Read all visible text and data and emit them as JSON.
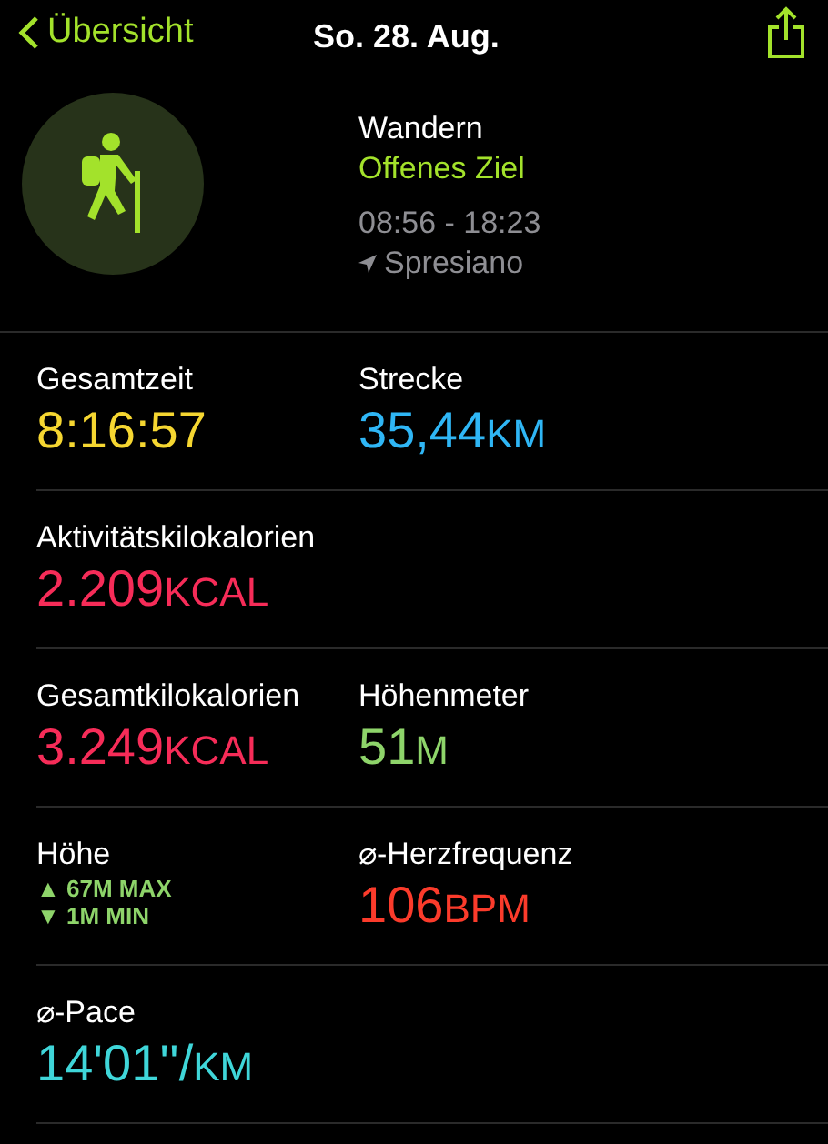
{
  "nav": {
    "back_label": "Übersicht",
    "title": "So. 28. Aug."
  },
  "workout": {
    "name": "Wandern",
    "goal": "Offenes Ziel",
    "time_range": "08:56 - 18:23",
    "location": "Spresiano"
  },
  "metric_rows": [
    {
      "cells": [
        {
          "kind": "value",
          "label": "Gesamtzeit",
          "value": "8:16:57",
          "color": "#f5d631"
        },
        {
          "kind": "value",
          "label": "Strecke",
          "value": "35,44",
          "unit": "KM",
          "color": "#2fb6f5"
        }
      ]
    },
    {
      "cells": [
        {
          "kind": "value",
          "label": "Aktivitätskilokalorien",
          "value": "2.209",
          "unit": "KCAL",
          "color": "#f62c58"
        }
      ]
    },
    {
      "cells": [
        {
          "kind": "value",
          "label": "Gesamtkilokalorien",
          "value": "3.249",
          "unit": "KCAL",
          "color": "#f62c58"
        },
        {
          "kind": "value",
          "label": "Höhenmeter",
          "value": "51",
          "unit": "M",
          "color": "#8ed46a"
        }
      ]
    },
    {
      "cells": [
        {
          "kind": "range",
          "label": "Höhe",
          "lines": [
            "▲ 67M MAX",
            "▼ 1M MIN"
          ],
          "color": "#8ed46a"
        },
        {
          "kind": "value",
          "label": "⌀-Herzfrequenz",
          "value": "106",
          "unit": "BPM",
          "color": "#fb3b2b"
        }
      ]
    },
    {
      "cells": [
        {
          "kind": "value",
          "label": "⌀-Pace",
          "value": "14'01''/",
          "unit": "KM",
          "color": "#3fd6d9"
        }
      ]
    }
  ]
}
